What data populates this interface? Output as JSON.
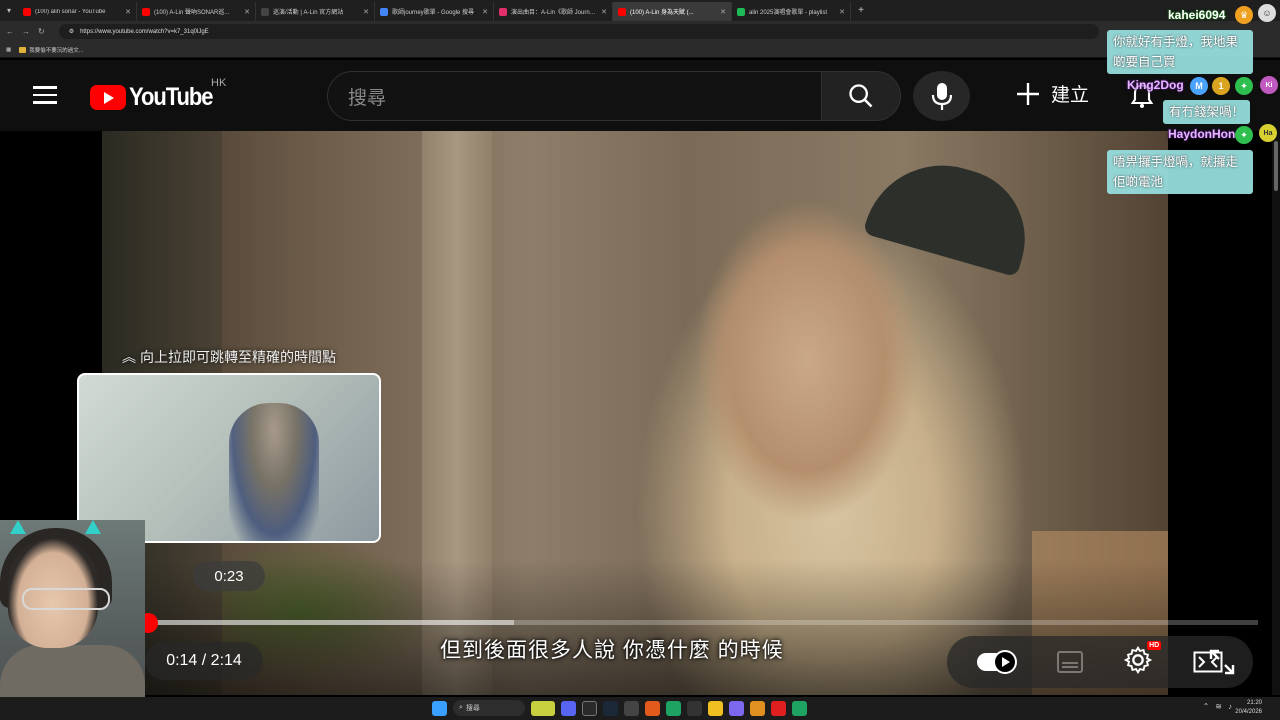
{
  "browser": {
    "tabs": [
      {
        "title": "(100) alin sonar - YouTube",
        "color": "#ff0000"
      },
      {
        "title": "(100) A-Lin 聲吶SONAR巡...",
        "color": "#ff0000"
      },
      {
        "title": "巡演/活動 | A-Lin 官方網站",
        "color": "#444444"
      },
      {
        "title": "歌師journey歌單 - Google 搜尋",
        "color": "#4285f4"
      },
      {
        "title": "演出曲目：A-Lin《歌師 Journe...",
        "color": "#e3306c"
      },
      {
        "title": "(100) A-Lin 身為天賦 (...",
        "color": "#ff0000"
      },
      {
        "title": "alin 2025演唱會歌單 - playlist",
        "color": "#1db954"
      }
    ],
    "new_tab_label": "+",
    "url": "https://www.youtube.com/watch?v=k7_31q0lJgE",
    "bookmark_label": "我要偷不要沉的過文..."
  },
  "youtube": {
    "logo_text": "YouTube",
    "region": "HK",
    "search_placeholder": "搜尋",
    "create_label": "建立"
  },
  "player": {
    "seek_hint": "向上拉即可跳轉至精確的時間點",
    "preview_time": "0:23",
    "current_time": "0:14",
    "duration": "2:14",
    "time_display": "0:14 / 2:14",
    "subtitle": "但到後面很多人說 你憑什麼 的時候",
    "played_fraction": 0.0,
    "loaded_fraction": 0.33,
    "hd_badge": "HD"
  },
  "chat": [
    {
      "user": "kahei6094",
      "message": "你就好有手燈，我地果啲要自己買"
    },
    {
      "user": "King2Dog",
      "message": "有冇錢架喎！"
    },
    {
      "user": "HaydonHon",
      "message": "唔畀攞手燈喎，就攞走佢啲電池"
    }
  ],
  "taskbar": {
    "search_label": "搜尋",
    "time": "21:20",
    "date": "20/4/2026"
  }
}
